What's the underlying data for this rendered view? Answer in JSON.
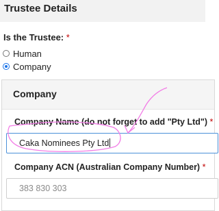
{
  "section": {
    "title": "Trustee Details"
  },
  "trustee_type": {
    "label": "Is the Trustee:",
    "required_mark": "*",
    "options": [
      {
        "label": "Human",
        "selected": false
      },
      {
        "label": "Company",
        "selected": true
      }
    ]
  },
  "company_panel": {
    "title": "Company",
    "company_name": {
      "label": "Company Name (do not forget to add \"Pty Ltd\")",
      "required_mark": "*",
      "value": "Caka Nominees Pty Ltd"
    },
    "company_acn": {
      "label": "Company ACN (Australian Company Number)",
      "required_mark": "*",
      "value": "383 830 303"
    }
  },
  "colors": {
    "annotation": "#f27ce6",
    "required": "#c00000",
    "focus": "#4a90d9"
  }
}
